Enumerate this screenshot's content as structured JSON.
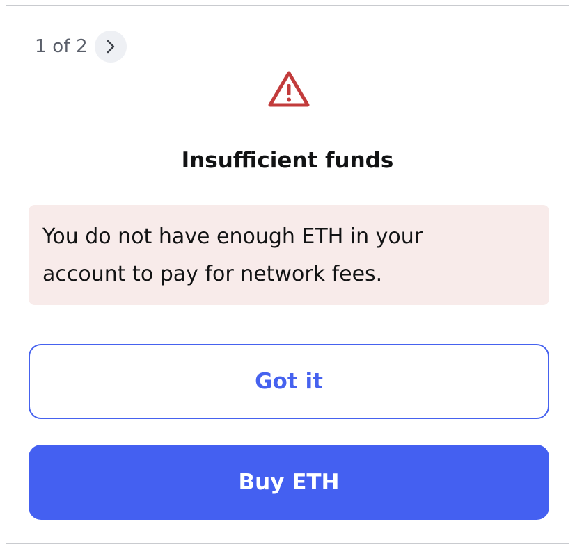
{
  "pager": {
    "text": "1 of 2",
    "next_icon": "chevron-right-icon"
  },
  "alert": {
    "icon": "warning-triangle-icon",
    "icon_color": "#c23b3b",
    "title": "Insufficient funds",
    "message": "You do not have enough ETH in your\naccount to pay for network fees.",
    "background_color": "#f8ebea"
  },
  "buttons": {
    "secondary_label": "Got it",
    "primary_label": "Buy ETH",
    "accent_color": "#4662ef"
  }
}
